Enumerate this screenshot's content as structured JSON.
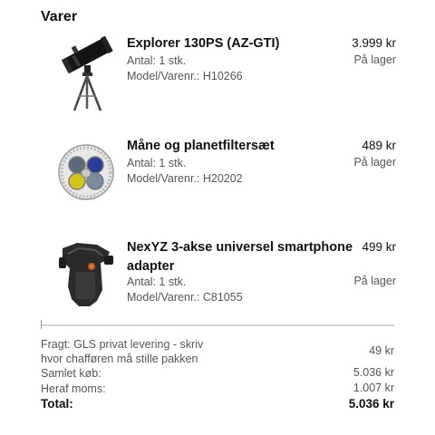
{
  "section": {
    "title": "Varer"
  },
  "items": [
    {
      "name": "Explorer 130PS (AZ-GTI)",
      "qty": "Antal: 1 stk.",
      "model": "Model/Varenr.: H10266",
      "price": "3.999 kr",
      "stock": "På lager",
      "icon": "telescope-icon"
    },
    {
      "name": "Måne og planetfiltersæt",
      "qty": "Antal: 1 stk.",
      "model": "Model/Varenr.: H20202",
      "price": "489 kr",
      "stock": "På lager",
      "icon": "filter-set-icon"
    },
    {
      "name_line1": "NexYZ 3-akse universel smartphone",
      "name_line2": "adapter",
      "qty": "Antal: 1 stk.",
      "model": "Model/Varenr.: C81055",
      "price": "499 kr",
      "stock": "På lager",
      "icon": "smartphone-adapter-icon"
    }
  ],
  "summary": {
    "shipping_label_line1": "Fragt: GLS privat levering - skriv",
    "shipping_label_line2": "hvor chafføren må stille pakken",
    "shipping_value": "49 kr",
    "subtotal_label": "Samlet køb:",
    "subtotal_value": "5.036 kr",
    "vat_label": "Heraf moms:",
    "vat_value": "1.007 kr",
    "total_label": "Total:",
    "total_value": "5.036 kr"
  }
}
